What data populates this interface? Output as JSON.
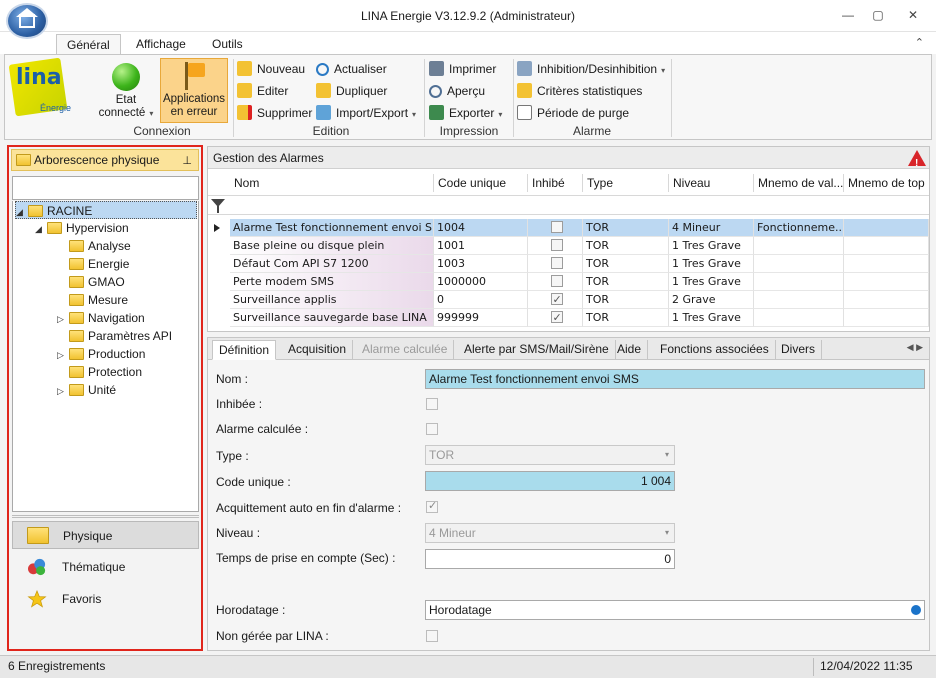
{
  "window": {
    "title": "LINA Energie  V3.12.9.2  (Administrateur)",
    "minimize": "—",
    "maximize": "▢",
    "close": "✕"
  },
  "ribbon_tabs": [
    {
      "label": "Général"
    },
    {
      "label": "Affichage"
    },
    {
      "label": "Outils"
    }
  ],
  "ribbon": {
    "logo": {
      "text": "lina",
      "sub": "Énergie"
    },
    "connexion": {
      "etat_line1": "Etat",
      "etat_line2": "connecté",
      "applications_line1": "Applications",
      "applications_line2": "en erreur",
      "group_label": "Connexion"
    },
    "edition": {
      "nouveau": "Nouveau",
      "editer": "Editer",
      "supprimer": "Supprimer",
      "actualiser": "Actualiser",
      "dupliquer": "Dupliquer",
      "import_export": "Import/Export",
      "group_label": "Edition"
    },
    "impression": {
      "imprimer": "Imprimer",
      "apercu": "Aperçu",
      "exporter": "Exporter",
      "group_label": "Impression"
    },
    "alarme": {
      "inhibition": "Inhibition/Desinhibition",
      "criteres": "Critères statistiques",
      "purge": "Période de purge",
      "group_label": "Alarme"
    },
    "colors": {
      "pressed": "#fbd38a"
    }
  },
  "left_panel": {
    "header": "Arborescence physique",
    "search": "",
    "tree": [
      {
        "label": "RACINE",
        "expander": "◢",
        "selected": true
      },
      {
        "label": "Hypervision",
        "expander": "◢"
      },
      {
        "label": "Analyse",
        "expander": ""
      },
      {
        "label": "Energie",
        "expander": ""
      },
      {
        "label": "GMAO",
        "expander": ""
      },
      {
        "label": "Mesure",
        "expander": ""
      },
      {
        "label": "Navigation",
        "expander": "▷"
      },
      {
        "label": "Paramètres API",
        "expander": ""
      },
      {
        "label": "Production",
        "expander": "▷"
      },
      {
        "label": "Protection",
        "expander": ""
      },
      {
        "label": "Unité",
        "expander": "▷"
      }
    ],
    "nav": [
      {
        "label": "Physique",
        "icon": "folder-icon"
      },
      {
        "label": "Thématique",
        "icon": "thematic-icon"
      },
      {
        "label": "Favoris",
        "icon": "star-icon"
      }
    ]
  },
  "alarms": {
    "title": "Gestion des Alarmes",
    "columns": [
      "Nom",
      "Code unique",
      "Inhibé",
      "Type",
      "Niveau",
      "Mnemo de val...",
      "Mnemo de top"
    ],
    "rows": [
      {
        "nom": "Alarme Test fonctionnement envoi S...",
        "code": "1004",
        "inhibe": false,
        "type": "TOR",
        "niveau": "4 Mineur",
        "mnemo_val": "Fonctionneme...",
        "mnemo_top": ""
      },
      {
        "nom": "Base pleine ou disque plein",
        "code": "1001",
        "inhibe": false,
        "type": "TOR",
        "niveau": "1 Tres Grave",
        "mnemo_val": "",
        "mnemo_top": ""
      },
      {
        "nom": "Défaut Com API S7 1200",
        "code": "1003",
        "inhibe": false,
        "type": "TOR",
        "niveau": "1 Tres Grave",
        "mnemo_val": "",
        "mnemo_top": ""
      },
      {
        "nom": "Perte modem SMS",
        "code": "1000000",
        "inhibe": false,
        "type": "TOR",
        "niveau": "1 Tres Grave",
        "mnemo_val": "",
        "mnemo_top": ""
      },
      {
        "nom": "Surveillance applis",
        "code": "0",
        "inhibe": true,
        "type": "TOR",
        "niveau": "2 Grave",
        "mnemo_val": "",
        "mnemo_top": ""
      },
      {
        "nom": "Surveillance sauvegarde base LINA",
        "code": "999999",
        "inhibe": true,
        "type": "TOR",
        "niveau": "1 Tres Grave",
        "mnemo_val": "",
        "mnemo_top": ""
      }
    ]
  },
  "detail": {
    "tabs": [
      {
        "label": "Définition"
      },
      {
        "label": "Acquisition"
      },
      {
        "label": "Alarme calculée"
      },
      {
        "label": "Alerte par SMS/Mail/Sirène"
      },
      {
        "label": "Aide"
      },
      {
        "label": "Fonctions associées"
      },
      {
        "label": "Divers"
      }
    ],
    "labels": {
      "nom": "Nom :",
      "inhibee": "Inhibée :",
      "calculee": "Alarme calculée :",
      "type": "Type :",
      "code": "Code unique :",
      "acquittement": "Acquittement auto en fin d'alarme :",
      "niveau": "Niveau :",
      "temps": "Temps de prise en compte (Sec) :",
      "horodatage": "Horodatage :",
      "non_geree": "Non gérée par LINA :"
    },
    "values": {
      "nom": "Alarme Test fonctionnement envoi SMS",
      "type": "TOR",
      "code": "1 004",
      "niveau": "4 Mineur",
      "temps": "0",
      "horodatage": "Horodatage",
      "inhibee": false,
      "calculee": false,
      "acquittement": true,
      "non_geree": false
    }
  },
  "status": {
    "count": "6 Enregistrements",
    "datetime": "12/04/2022 11:35"
  }
}
